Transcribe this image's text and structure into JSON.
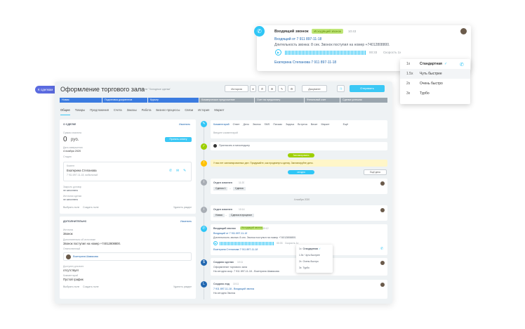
{
  "header": {
    "back": "К сделкам",
    "title": "Оформление торгового зала",
    "subtitle": "в отделе \"Холодные сделки\"",
    "history": "История",
    "edit": "Редактировать",
    "more": "Документ",
    "save": "Отправить",
    "rating": "10"
  },
  "stages": [
    "Новая",
    "Подготовка документов",
    "Курьер",
    "Коммерческое предложение",
    "Счет на предоплату",
    "Финальный счет",
    "Сделка успешна"
  ],
  "tabs": [
    "Общие",
    "Товары",
    "Предложения",
    "Счета",
    "Заказы",
    "Работа",
    "Бизнес-процессы",
    "Связи",
    "История",
    "Маркет"
  ],
  "about": {
    "header": "О СДЕЛКЕ",
    "action": "Изменить",
    "sum_label": "Сумма и валюта",
    "sum": "0",
    "currency": "руб.",
    "pay_button": "Принять оплату",
    "date_label": "Дата завершения",
    "date": "4 ноября 2020",
    "stage_label": "Стадия",
    "client_label": "Клиент",
    "client_name": "Екатерина Степанова",
    "client_phone": "7 911 897-11-18, мобильный",
    "source_label": "Закрыть договор",
    "source_val": "не заполнено",
    "resp_label": "Источник сделки",
    "resp_val": "не заполнено",
    "select": "Выбрать поле",
    "create": "Создать поле",
    "delete": "Удалить раздел"
  },
  "extra": {
    "header": "ДОПОЛНИТЕЛЬНО",
    "action": "Изменить",
    "type_label": "Источник",
    "type": "Звонок",
    "src_label": "Дополнительно об источнике",
    "src": "Звонок поступил на номер +74012808800.",
    "resp_label": "Ответственный",
    "resp": "Екатерина Шамякова",
    "t_label": "Доступен для всех",
    "t": "отсутствует",
    "x_label": "Комментарий",
    "x": "Пустой график",
    "select": "Выбрать поле",
    "create": "Создать поле",
    "delete": "Удалить раздел"
  },
  "activity": {
    "tabs": [
      "Комментарий",
      "Ответ",
      "Дело",
      "Звонок",
      "SMS",
      "Письмо",
      "Задача",
      "Встреча",
      "Визит",
      "Маркет",
      "Ещё"
    ],
    "placeholder": "Введите комментарий",
    "call_sent": "Пригласить в мессенджер",
    "planned": "Запланировано",
    "notice": "У вас нет запланированных дел. Придумайте, как продвинуть сделку. Запланируйте дело.",
    "today": "сегодня",
    "schedule": "Ещё дела",
    "date": "4 ноября 2020"
  },
  "tl": [
    {
      "title": "Отдел изменен",
      "time": "11:20",
      "from": "Сделка 1",
      "to": "Сделка"
    },
    {
      "title": "Отдел изменен",
      "time": "10:14",
      "from": "Новая",
      "to": "Сделка в процессе"
    },
    {
      "title": "Входящий звонок",
      "badge": "Исходящий звонок",
      "time": "10:12",
      "line1": "Входящий от 7 911 897-11-18",
      "line2": "Длительность звонка: 8 сек. Звонок поступил на номер +74012808800.",
      "dur": "00:33",
      "speed": "Скорость 1x",
      "contact": "Екатерина Степанова 7 911 897-11-18"
    },
    {
      "title": "Создано сделки",
      "time": "10:11",
      "line1": "Оформление торгового зала",
      "line2": "На сегодня скор. 7 911 897-11-18 - Екатерина Шамякова"
    },
    {
      "title": "Создано лид",
      "time": "10:11",
      "line1": "7 911 897-11-18 - Входящий звонок",
      "line2": "На сегодня Звонок"
    }
  ],
  "popup": {
    "title": "Входящий звонок",
    "badge": "Исходящий звонок",
    "time": "10:43",
    "line1": "Входящий от 7 911 897-11-18",
    "line2": "Длительность звонка: 8 сек. Звонок поступил на номер +74012808800.",
    "dur": "00:33",
    "speed": "Скорость 1x",
    "contact": "Екатерина Степанова 7 911 897-11-18"
  },
  "speed_menu": [
    {
      "k": "1x",
      "v": "Стандартная"
    },
    {
      "k": "1.5x",
      "v": "Чуть быстрее"
    },
    {
      "k": "2x",
      "v": "Очень быстро"
    },
    {
      "k": "3x",
      "v": "Турбо"
    }
  ],
  "colors": {
    "accent": "#3bc8f5",
    "green": "#9dcf00",
    "back": "#5b6be0"
  }
}
